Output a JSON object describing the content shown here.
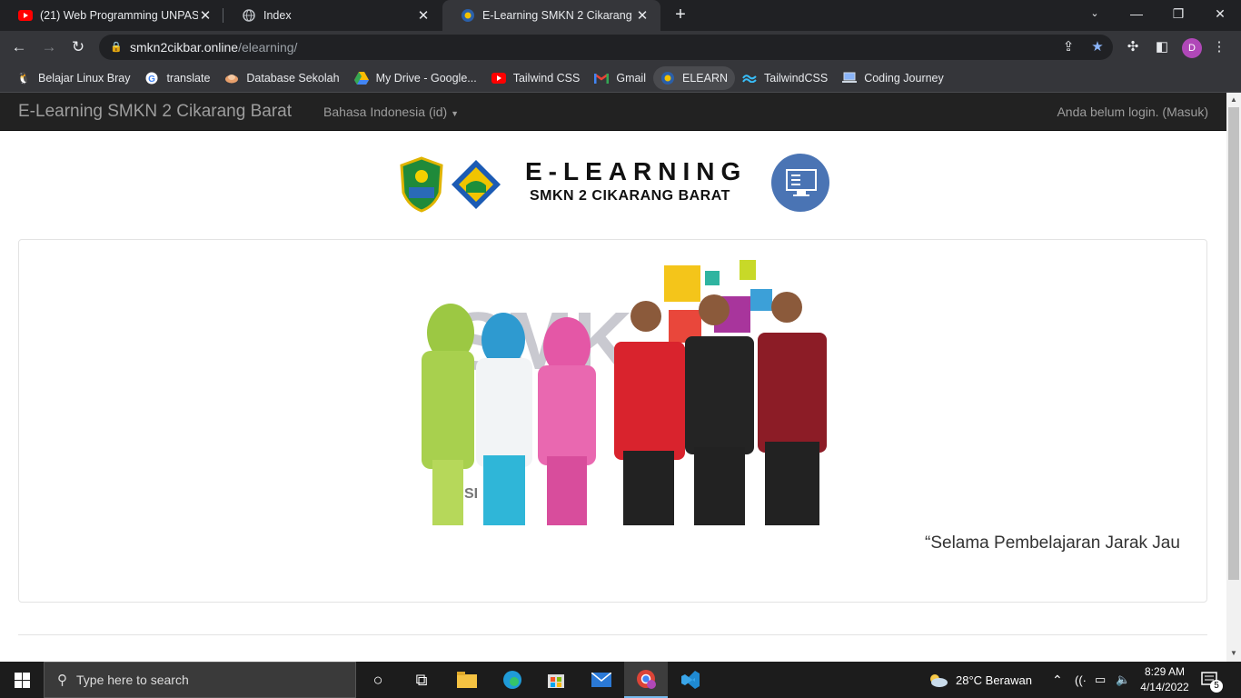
{
  "browser": {
    "tabs": [
      {
        "title": "(21) Web Programming UNPAS -",
        "icon": "youtube-icon",
        "active": false
      },
      {
        "title": "Index",
        "icon": "globe-icon",
        "active": false
      },
      {
        "title": "E-Learning SMKN 2 Cikarang Barat",
        "icon": "moodle-icon",
        "active": true
      }
    ],
    "url_host": "smkn2cikbar.online",
    "url_path": "/elearning/",
    "profile_initial": "D",
    "bookmarks": [
      {
        "label": "Belajar Linux Bray",
        "icon": "linux-icon"
      },
      {
        "label": "translate",
        "icon": "google-icon"
      },
      {
        "label": "Database Sekolah",
        "icon": "database-icon"
      },
      {
        "label": "My Drive - Google...",
        "icon": "drive-icon"
      },
      {
        "label": "Tailwind CSS",
        "icon": "youtube-icon"
      },
      {
        "label": "Gmail",
        "icon": "gmail-icon"
      },
      {
        "label": "ELEARN",
        "icon": "moodle-icon"
      },
      {
        "label": "TailwindCSS",
        "icon": "tailwind-icon"
      },
      {
        "label": "Coding Journey",
        "icon": "laptop-icon"
      }
    ]
  },
  "site": {
    "brand": "E-Learning SMKN 2 Cikarang Barat",
    "language": "Bahasa Indonesia (id)",
    "login_status": "Anda belum login. (Masuk)",
    "header_title": "E-LEARNING",
    "header_subtitle": "SMKN 2 CIKARANG BARAT",
    "marquee_text": "“Selama Pembelajaran Jarak Jau"
  },
  "taskbar": {
    "search_placeholder": "Type here to search",
    "weather": "28°C  Berawan",
    "time": "8:29 AM",
    "date": "4/14/2022",
    "notification_count": "5"
  },
  "colors": {
    "nav_bg": "#222222",
    "chrome_dark": "#202124",
    "chrome_toolbar": "#35363a"
  }
}
